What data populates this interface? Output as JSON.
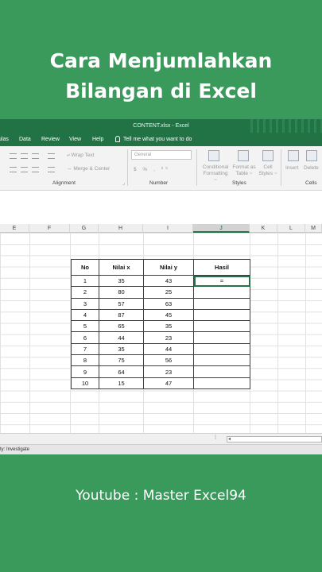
{
  "headline": {
    "line1": "Cara Menjumlahkan",
    "line2": "Bilangan di Excel"
  },
  "window": {
    "title": "CONTENT.xlsx  -  Excel"
  },
  "menu": {
    "items": [
      "ulas",
      "Data",
      "Review",
      "View",
      "Help"
    ],
    "tell_me": "Tell me what you want to do"
  },
  "ribbon": {
    "wrap_text": "Wrap Text",
    "merge_center": "Merge & Center",
    "number_format": "General",
    "conditional_formatting": [
      "Conditional",
      "Formatting ~"
    ],
    "format_as_table": [
      "Format as",
      "Table ~"
    ],
    "cell_styles": [
      "Cell",
      "Styles ~"
    ],
    "insert": "Insert",
    "delete": "Delete",
    "groups": {
      "alignment": "Alignment",
      "number": "Number",
      "styles": "Styles",
      "cells": "Cells"
    }
  },
  "columns": [
    "E",
    "F",
    "G",
    "H",
    "I",
    "J",
    "K",
    "L",
    "M"
  ],
  "selected_column": "J",
  "table": {
    "headers": [
      "No",
      "Nilai x",
      "Nilai y",
      "Hasil"
    ],
    "rows": [
      [
        "1",
        "35",
        "43",
        "="
      ],
      [
        "2",
        "80",
        "25",
        ""
      ],
      [
        "3",
        "57",
        "63",
        ""
      ],
      [
        "4",
        "87",
        "45",
        ""
      ],
      [
        "5",
        "65",
        "35",
        ""
      ],
      [
        "6",
        "44",
        "23",
        ""
      ],
      [
        "7",
        "35",
        "44",
        ""
      ],
      [
        "8",
        "75",
        "56",
        ""
      ],
      [
        "9",
        "64",
        "23",
        ""
      ],
      [
        "10",
        "15",
        "47",
        ""
      ]
    ]
  },
  "status": {
    "text": "ty: Investigate",
    "scroll_dots": "⁞"
  },
  "footer": {
    "text": "Youtube : Master Excel94"
  },
  "colors": {
    "background": "#3a9a5b",
    "excel_green": "#217346"
  }
}
